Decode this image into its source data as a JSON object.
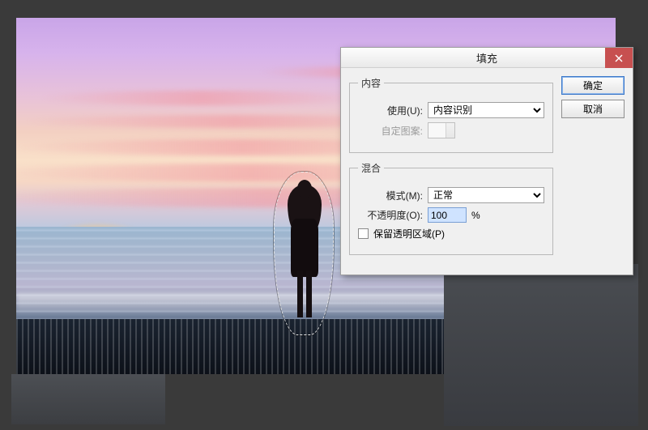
{
  "dialog": {
    "title": "填充",
    "ok_label": "确定",
    "cancel_label": "取消",
    "content_group": {
      "legend": "内容",
      "use_label": "使用(U):",
      "use_value": "内容识别",
      "custom_pattern_label": "自定图案:"
    },
    "blend_group": {
      "legend": "混合",
      "mode_label": "模式(M):",
      "mode_value": "正常",
      "opacity_label": "不透明度(O):",
      "opacity_value": "100",
      "opacity_suffix": "%",
      "preserve_label": "保留透明区域(P)"
    }
  }
}
